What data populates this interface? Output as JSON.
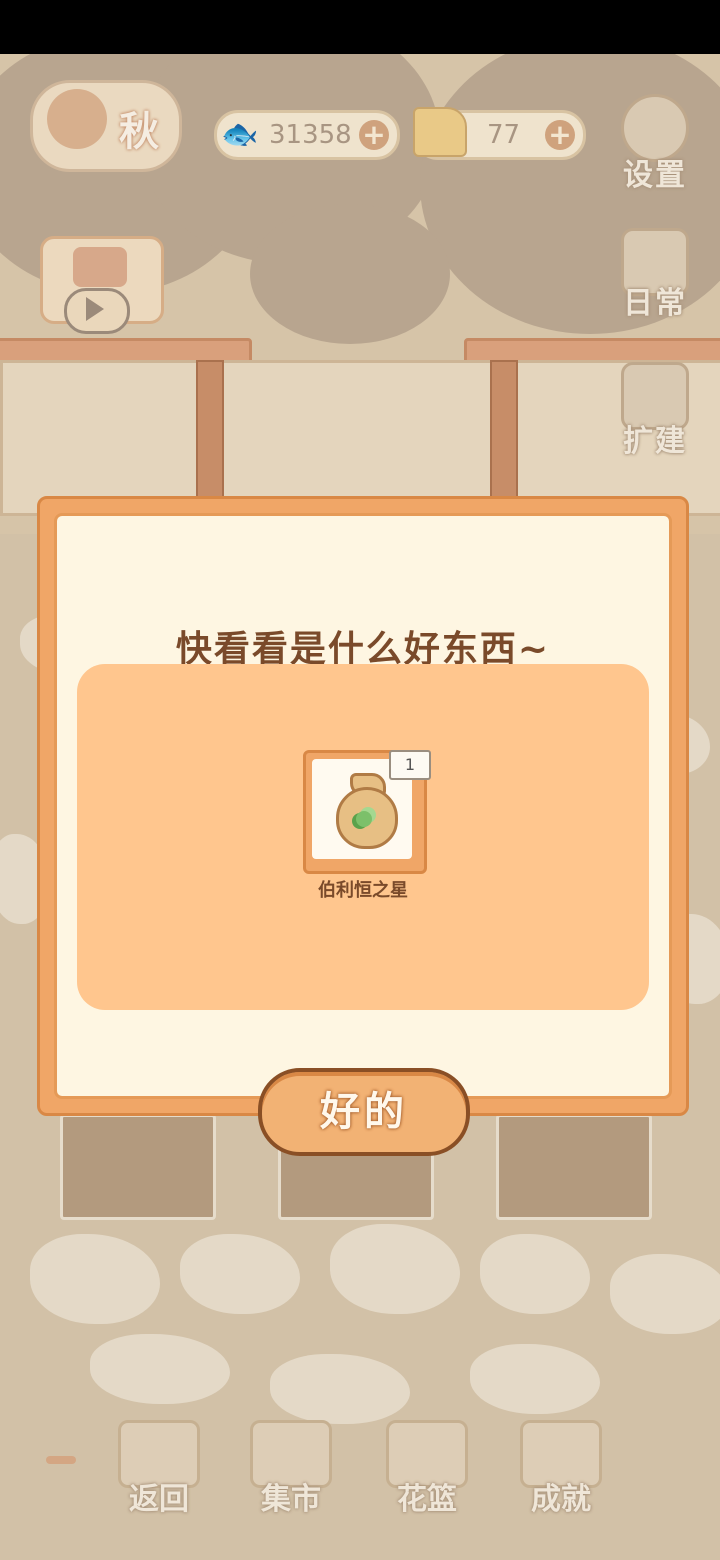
{
  "hud": {
    "season": "秋",
    "fish_currency": "31358",
    "cheese_currency": "77"
  },
  "side_menu": [
    {
      "label": "设置",
      "icon": "gear-icon"
    },
    {
      "label": "日常",
      "icon": "tip-notes-icon"
    },
    {
      "label": "扩建",
      "icon": "hammer-icon"
    }
  ],
  "dialog": {
    "title": "快看看是什么好东西~",
    "reward": {
      "name": "伯利恒之星",
      "quantity": "1",
      "icon": "seed-bag-icon"
    },
    "confirm_label": "好的"
  },
  "bottom_nav": [
    {
      "label": "返回",
      "icon": "window-icon"
    },
    {
      "label": "集市",
      "icon": "market-stall-icon"
    },
    {
      "label": "花篮",
      "icon": "flower-basket-icon"
    },
    {
      "label": "成就",
      "icon": "trophy-icon"
    }
  ],
  "colors": {
    "dialog_border": "#f0a667",
    "dialog_bg": "#fef6e2",
    "reward_panel": "#ffc68e",
    "title_text": "#7a4a2a"
  }
}
